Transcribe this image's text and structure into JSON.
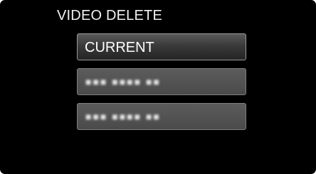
{
  "screen": {
    "title": "VIDEO DELETE",
    "menu": [
      {
        "label": "CURRENT",
        "state": "selected"
      },
      {
        "label": "",
        "state": "blurred"
      },
      {
        "label": "",
        "state": "blurred"
      }
    ]
  },
  "colors": {
    "background": "#000000",
    "text": "#ffffff",
    "selected_top": "#5a5a5a",
    "selected_bottom": "#242424",
    "dimmed_item": "#505050",
    "border": "#8a8a8a"
  }
}
